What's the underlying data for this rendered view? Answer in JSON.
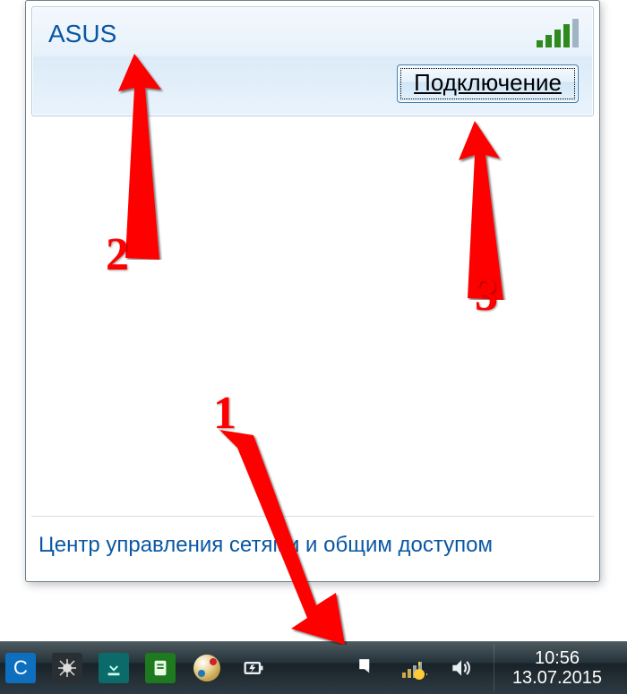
{
  "network": {
    "name": "ASUS",
    "connect_label": "Подключение"
  },
  "footer": {
    "link": "Центр управления сетями и общим доступом"
  },
  "taskbar": {
    "clock_time": "10:56",
    "clock_date": "13.07.2015"
  },
  "annotations": {
    "n1": "1",
    "n2": "2",
    "n3": "3"
  }
}
